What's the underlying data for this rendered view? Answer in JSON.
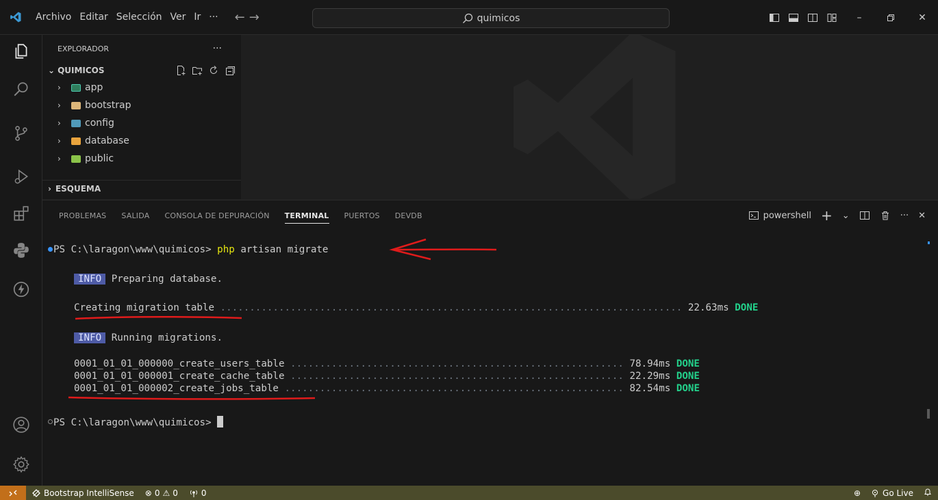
{
  "menu": [
    "Archivo",
    "Editar",
    "Selección",
    "Ver",
    "Ir",
    "···"
  ],
  "command_center": {
    "text": "quimicos"
  },
  "explorer": {
    "title": "EXPLORADOR",
    "dots": "···",
    "project": "QUIMICOS",
    "items": [
      {
        "label": "app",
        "color": "#4ec9b0"
      },
      {
        "label": "bootstrap",
        "color": "#dcb67a"
      },
      {
        "label": "config",
        "color": "#519aba"
      },
      {
        "label": "database",
        "color": "#e8a33d"
      },
      {
        "label": "public",
        "color": "#8bc34a"
      }
    ],
    "outline": "ESQUEMA"
  },
  "panel": {
    "tabs": [
      "PROBLEMAS",
      "SALIDA",
      "CONSOLA DE DEPURACIÓN",
      "TERMINAL",
      "PUERTOS",
      "DEVDB"
    ],
    "active_tab": "TERMINAL",
    "shell": "powershell"
  },
  "terminal": {
    "prompt": "PS C:\\laragon\\www\\quimicos>",
    "cmd_php": "php",
    "cmd_rest": "artisan migrate",
    "info_badge": "INFO",
    "info1": "Preparing database.",
    "creating": "Creating migration table",
    "creating_dots": "...............................................................................",
    "creating_time": "22.63ms",
    "done": "DONE",
    "info2": "Running migrations.",
    "migrations": [
      {
        "name": "0001_01_01_000000_create_users_table",
        "dots": ".........................................................",
        "time": "78.94ms"
      },
      {
        "name": "0001_01_01_000001_create_cache_table",
        "dots": ".........................................................",
        "time": "22.29ms"
      },
      {
        "name": "0001_01_01_000002_create_jobs_table",
        "dots": "..........................................................",
        "time": "82.54ms"
      }
    ],
    "prompt2": "PS C:\\laragon\\www\\quimicos>"
  },
  "statusbar": {
    "extension": "Bootstrap IntelliSense",
    "errors": "0",
    "warnings": "0",
    "ports": "0",
    "golive": "Go Live"
  },
  "colors": {
    "accent_blue": "#3794ff",
    "annotation_red": "#e01b1b",
    "statusbar": "#4b4b2b",
    "remote": "#c26f1a"
  }
}
